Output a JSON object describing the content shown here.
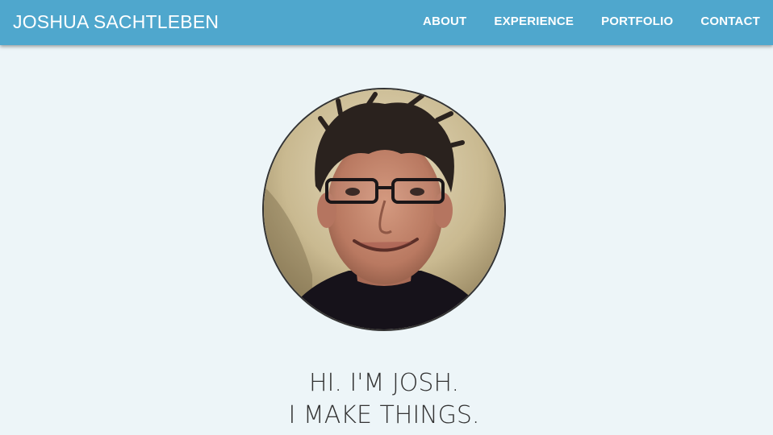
{
  "header": {
    "brand": "JOSHUA SACHTLEBEN",
    "nav": [
      {
        "label": "ABOUT"
      },
      {
        "label": "EXPERIENCE"
      },
      {
        "label": "PORTFOLIO"
      },
      {
        "label": "CONTACT"
      }
    ]
  },
  "hero": {
    "line1": "HI. I'M JOSH.",
    "line2": "I MAKE THINGS."
  },
  "colors": {
    "navbar": "#4fa7cd",
    "background": "#edf5f8",
    "text": "#333333"
  }
}
